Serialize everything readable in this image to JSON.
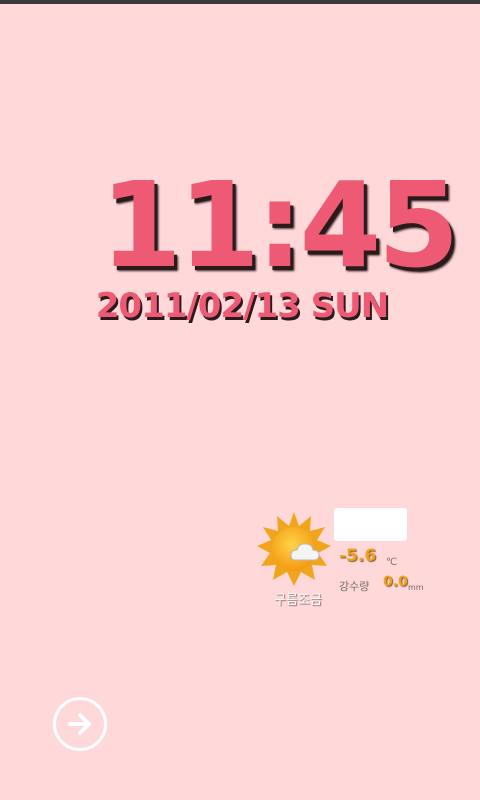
{
  "clock": {
    "time": "11:45",
    "date": "2011/02/13 SUN"
  },
  "weather": {
    "condition": "구름조금",
    "icon": "sun-cloud-icon",
    "temperature": "-5.6",
    "temperature_unit": "℃",
    "precip_label": "강수량",
    "precip_value": "0.0",
    "precip_unit": "mm"
  },
  "unlock": {
    "icon": "arrow-right-icon"
  },
  "colors": {
    "background": "#ffd9da",
    "accent": "#ee5a73",
    "temp": "#f2a21a"
  }
}
